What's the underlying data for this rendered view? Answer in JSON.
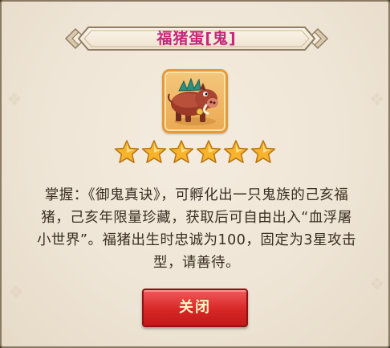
{
  "dialog": {
    "title": "福猪蛋[鬼]",
    "item": {
      "icon": "boar-pet-icon",
      "star_count": 6,
      "star_max": 6
    },
    "description_lines": [
      "掌握：《御鬼真诀》，可孵化出一只鬼族的己亥福",
      "猪，己亥年限量珍藏，获取后可自由出入“血浮屠",
      "小世界”。福猪出生时忠诚为100，固定为3星攻击",
      "型，请善待。"
    ],
    "close_label": "关闭"
  },
  "colors": {
    "title": "#c8287a",
    "panel": "#efe5d6",
    "star": "#f7b32b",
    "button": "#d82626",
    "button_text": "#fff7c8",
    "icon_frame": "#e59a3a"
  }
}
